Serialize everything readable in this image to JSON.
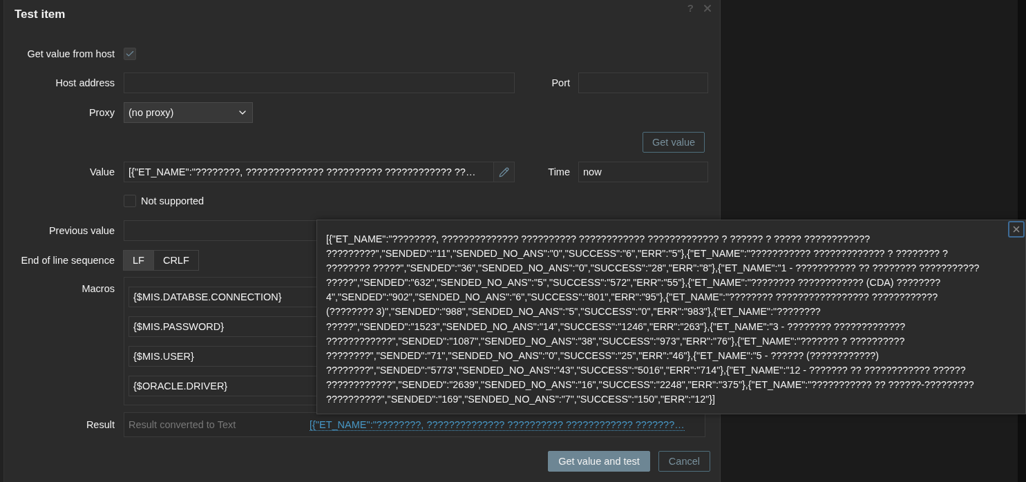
{
  "dialog": {
    "title": "Test item",
    "help": "?"
  },
  "form": {
    "get_value_from_host": {
      "label": "Get value from host",
      "checked": true
    },
    "host_address": {
      "label": "Host address"
    },
    "port": {
      "label": "Port"
    },
    "proxy": {
      "label": "Proxy",
      "value": "(no proxy)"
    },
    "get_value_button": "Get value",
    "value": {
      "label": "Value",
      "value": "[{\"ET_NAME\":\"????????, ?????????????? ?????????? ???????????? ??…"
    },
    "time": {
      "label": "Time",
      "value": "now"
    },
    "not_supported": {
      "label": "Not supported",
      "checked": false
    },
    "previous_value": {
      "label": "Previous value"
    },
    "eol": {
      "label": "End of line sequence",
      "options": [
        {
          "label": "LF",
          "selected": true
        },
        {
          "label": "CRLF",
          "selected": false
        }
      ]
    },
    "macros": {
      "label": "Macros",
      "items": [
        {
          "name": "{$MIS.DATABSE.CONNECTION}"
        },
        {
          "name": "{$MIS.PASSWORD}"
        },
        {
          "name": "{$MIS.USER}"
        },
        {
          "name": "{$ORACLE.DRIVER}"
        }
      ]
    },
    "result": {
      "label": "Result",
      "placeholder": "Result converted to Text",
      "link": "[{\"ET_NAME\":\"????????, ?????????????? ?????????? ???????????? ???????…"
    }
  },
  "buttons": [
    {
      "label": "Get value and test",
      "kind": "primary"
    },
    {
      "label": "Cancel",
      "kind": "secondary"
    }
  ],
  "value_popup": {
    "lines": [
      "[{\"ET_NAME\":\"????????, ?????????????? ?????????? ???????????? ????????????? ? ?????? ? ????? ????????????",
      "?????????\",\"SENDED\":\"11\",\"SENDED_NO_ANS\":\"0\",\"SUCCESS\":\"6\",\"ERR\":\"5\"},{\"ET_NAME\":\"??????????? ????????????? ? ???????? ?",
      "???????? ?????\",\"SENDED\":\"36\",\"SENDED_NO_ANS\":\"0\",\"SUCCESS\":\"28\",\"ERR\":\"8\"},{\"ET_NAME\":\"1 - ??????????? ?? ???????? ???????????",
      "?????\",\"SENDED\":\"632\",\"SENDED_NO_ANS\":\"5\",\"SUCCESS\":\"572\",\"ERR\":\"55\"},{\"ET_NAME\":\"???????? ???????????? (CDA) ????????",
      "4\",\"SENDED\":\"902\",\"SENDED_NO_ANS\":\"6\",\"SUCCESS\":\"801\",\"ERR\":\"95\"},{\"ET_NAME\":\"???????? ????????????????? ????????????",
      "(???????? 3)\",\"SENDED\":\"988\",\"SENDED_NO_ANS\":\"5\",\"SUCCESS\":\"0\",\"ERR\":\"983\"},{\"ET_NAME\":\"????????",
      "?????\",\"SENDED\":\"1523\",\"SENDED_NO_ANS\":\"14\",\"SUCCESS\":\"1246\",\"ERR\":\"263\"},{\"ET_NAME\":\"3 - ???????? ?????????????",
      "????????????\",\"SENDED\":\"1087\",\"SENDED_NO_ANS\":\"38\",\"SUCCESS\":\"973\",\"ERR\":\"76\"},{\"ET_NAME\":\"??????? ? ??????????",
      "????????\",\"SENDED\":\"71\",\"SENDED_NO_ANS\":\"0\",\"SUCCESS\":\"25\",\"ERR\":\"46\"},{\"ET_NAME\":\"5 - ?????? (????????????)",
      "????????\",\"SENDED\":\"5773\",\"SENDED_NO_ANS\":\"43\",\"SUCCESS\":\"5016\",\"ERR\":\"714\"},{\"ET_NAME\":\"12 - ??????? ?? ???????????? ??????",
      "????????????\",\"SENDED\":\"2639\",\"SENDED_NO_ANS\":\"16\",\"SUCCESS\":\"2248\",\"ERR\":\"375\"},{\"ET_NAME\":\"??????????? ?? ??????-?????????",
      "??????????\",\"SENDED\":\"169\",\"SENDED_NO_ANS\":\"7\",\"SUCCESS\":\"150\",\"ERR\":\"12\"}]"
    ]
  }
}
